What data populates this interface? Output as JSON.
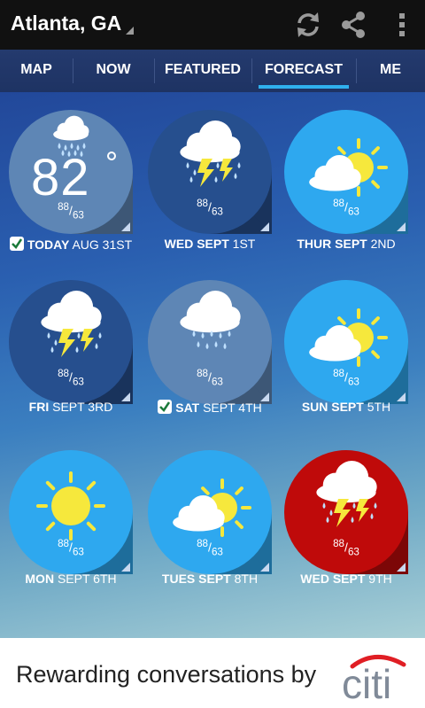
{
  "appbar": {
    "location": "Atlanta, GA",
    "actions": [
      "refresh-icon",
      "share-icon",
      "more-icon"
    ]
  },
  "tabs": [
    {
      "label": "MAP",
      "active": false
    },
    {
      "label": "NOW",
      "active": false
    },
    {
      "label": "FEATURED",
      "active": false
    },
    {
      "label": "FORECAST",
      "active": true
    },
    {
      "label": "ME",
      "active": false
    }
  ],
  "current_temp": "82",
  "forecast": [
    {
      "day": "TODAY",
      "date": "AUG 31ST",
      "hi": "88",
      "lo": "63",
      "icon": "rain-icon",
      "checked": true,
      "color": "#5e86b5"
    },
    {
      "day": "WED SEPT",
      "date": "1ST",
      "hi": "88",
      "lo": "63",
      "icon": "thunderstorm-icon",
      "checked": false,
      "color": "#264f8e"
    },
    {
      "day": "THUR SEPT",
      "date": "2ND",
      "hi": "88",
      "lo": "63",
      "icon": "partly-cloudy-icon",
      "checked": false,
      "color": "#2ea8ef"
    },
    {
      "day": "FRI",
      "date": "SEPT 3RD",
      "hi": "88",
      "lo": "63",
      "icon": "thunderstorm-icon",
      "checked": false,
      "color": "#264f8e"
    },
    {
      "day": "SAT",
      "date": "SEPT 4TH",
      "hi": "88",
      "lo": "63",
      "icon": "rain-icon",
      "checked": true,
      "color": "#5e86b5"
    },
    {
      "day": "SUN SEPT",
      "date": "5TH",
      "hi": "88",
      "lo": "63",
      "icon": "partly-cloudy-icon",
      "checked": false,
      "color": "#2ea8ef"
    },
    {
      "day": "MON",
      "date": "SEPT 6TH",
      "hi": "88",
      "lo": "63",
      "icon": "sunny-icon",
      "checked": false,
      "color": "#2ea8ef"
    },
    {
      "day": "TUES SEPT",
      "date": "8TH",
      "hi": "88",
      "lo": "63",
      "icon": "partly-cloudy-icon",
      "checked": false,
      "color": "#2ea8ef"
    },
    {
      "day": "WED SEPT",
      "date": "9TH",
      "hi": "88",
      "lo": "63",
      "icon": "thunderstorm-icon",
      "checked": false,
      "color": "#bf0a0a"
    }
  ],
  "ad": {
    "text": "Rewarding conversations by",
    "brand": "citi"
  }
}
